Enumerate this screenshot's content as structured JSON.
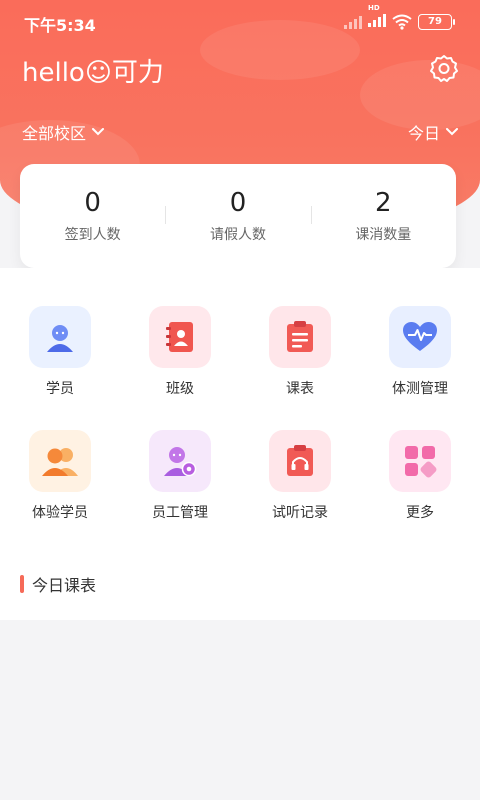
{
  "status": {
    "time": "下午5:34",
    "battery": "79",
    "network": "HD"
  },
  "header": {
    "greeting": "hello☺可力",
    "campus": "全部校区",
    "date_range": "今日"
  },
  "stats": [
    {
      "value": "0",
      "label": "签到人数"
    },
    {
      "value": "0",
      "label": "请假人数"
    },
    {
      "value": "2",
      "label": "课消数量"
    }
  ],
  "menu": [
    {
      "label": "学员",
      "icon": "student-icon"
    },
    {
      "label": "班级",
      "icon": "class-book-icon"
    },
    {
      "label": "课表",
      "icon": "schedule-icon"
    },
    {
      "label": "体测管理",
      "icon": "heart-rate-icon"
    },
    {
      "label": "体验学员",
      "icon": "trial-students-icon"
    },
    {
      "label": "员工管理",
      "icon": "staff-settings-icon"
    },
    {
      "label": "试听记录",
      "icon": "trial-record-icon"
    },
    {
      "label": "更多",
      "icon": "more-grid-icon"
    }
  ],
  "section": {
    "today_schedule": "今日课表"
  },
  "colors": {
    "brand": "#fa6c5a",
    "white": "#ffffff"
  }
}
